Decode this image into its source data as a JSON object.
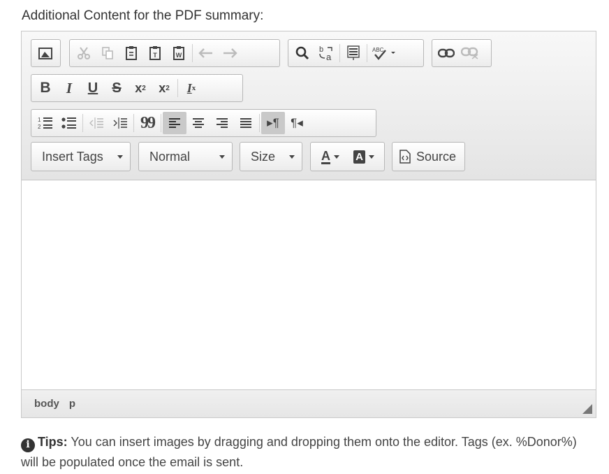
{
  "field_label": "Additional Content for the PDF summary:",
  "toolbar": {
    "row1": {
      "image_icon": "image-icon",
      "clipboard_group": [
        "cut-icon",
        "copy-icon",
        "paste-icon",
        "paste-text-icon",
        "paste-word-icon",
        "undo-icon",
        "redo-icon"
      ],
      "find_group": [
        "find-icon",
        "replace-icon",
        "select-all-icon",
        "spellcheck-icon"
      ],
      "link_group": [
        "link-icon",
        "unlink-icon"
      ]
    },
    "row2": {
      "bold": "B",
      "italic": "I",
      "underline": "U",
      "strike": "S",
      "sub": "x",
      "sub_mark": "2",
      "sup": "x",
      "sup_mark": "2",
      "clear": "I",
      "clear_mark": "x"
    },
    "row3": {
      "blockquote": "99",
      "ltr": "▸¶",
      "rtl": "¶◂"
    },
    "row4": {
      "insert_tags": "Insert Tags",
      "format": "Normal",
      "size": "Size",
      "text_color": "A",
      "bg_color": "A",
      "source": "Source"
    }
  },
  "statusbar": {
    "path": [
      "body",
      "p"
    ]
  },
  "tips": {
    "label": "Tips:",
    "text": " You can insert images by dragging and dropping them onto the editor. Tags (ex. %Donor%) will be populated once the email is sent."
  },
  "colors": {
    "toolbar_bg": "#e4e4e4",
    "border": "#b7b7b7",
    "active": "#c9c9c9"
  }
}
